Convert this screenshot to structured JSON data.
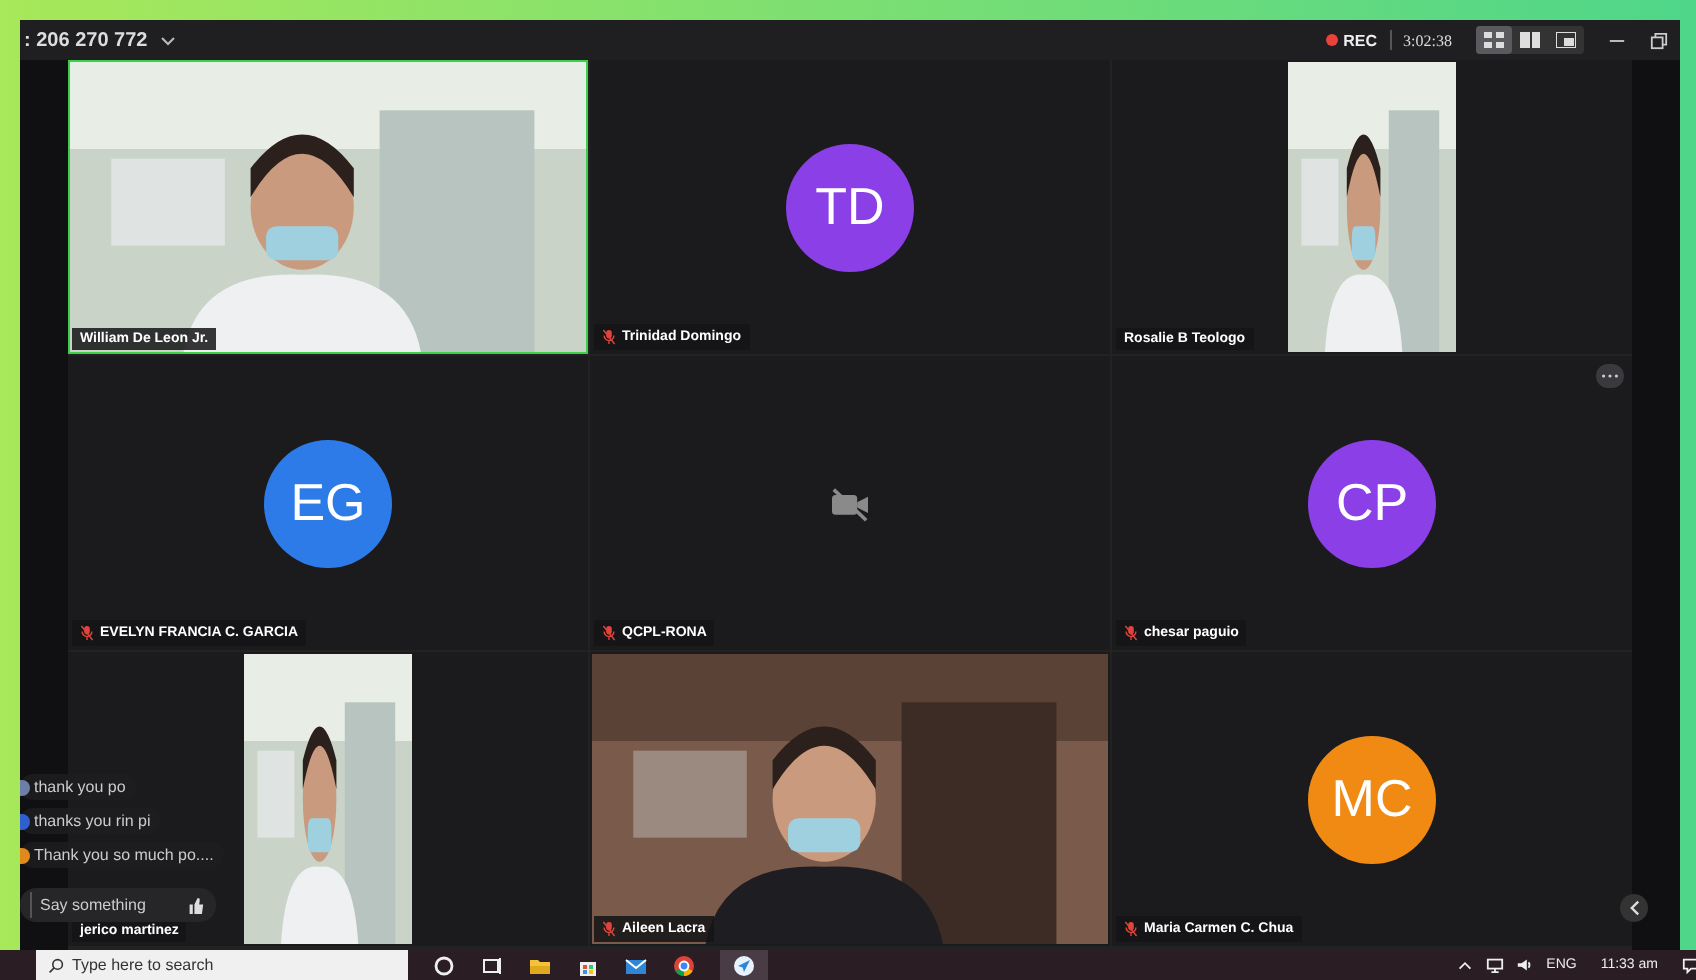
{
  "meeting": {
    "id": ": 206 270 772",
    "recording": true,
    "rec_label": "REC",
    "elapsed": "3:02:38",
    "views": [
      {
        "kind": "gallery",
        "selected": true
      },
      {
        "kind": "split",
        "selected": false
      },
      {
        "kind": "speaker",
        "selected": false
      }
    ]
  },
  "tiles": [
    {
      "kind": "video",
      "name": "William De Leon Jr.",
      "muted": false,
      "speaking": true
    },
    {
      "kind": "avatar",
      "initials": "TD",
      "color": "#8b3fe6",
      "name": "Trinidad Domingo",
      "muted": true,
      "speaking": false
    },
    {
      "kind": "portrait_video",
      "name": "Rosalie B Teologo",
      "muted": false,
      "speaking": false
    },
    {
      "kind": "avatar",
      "initials": "EG",
      "color": "#2d7be8",
      "name": "EVELYN FRANCIA C. GARCIA",
      "muted": true,
      "speaking": false
    },
    {
      "kind": "camera_off",
      "name": "QCPL-RONA",
      "muted": true,
      "speaking": false
    },
    {
      "kind": "avatar",
      "initials": "CP",
      "color": "#8b3fe6",
      "name": "chesar paguio",
      "muted": true,
      "speaking": false,
      "menu": true
    },
    {
      "kind": "portrait_video",
      "name": "jerico martinez",
      "muted": false,
      "speaking": false
    },
    {
      "kind": "video",
      "name": "Aileen Lacra",
      "muted": true,
      "speaking": false
    },
    {
      "kind": "avatar",
      "initials": "MC",
      "color": "#f08a12",
      "name": "Maria Carmen C. Chua",
      "muted": true,
      "speaking": false
    }
  ],
  "chat": {
    "messages": [
      {
        "text": "thank you po",
        "color": "#6d7fa8"
      },
      {
        "text": "thanks you rin pi",
        "color": "#2f5fd0"
      },
      {
        "text": "Thank you so much po....",
        "color": "#e08a1e"
      }
    ],
    "placeholder": "Say something"
  },
  "taskbar": {
    "search_placeholder": "Type here to search",
    "language": "ENG",
    "time": "11:33 am"
  }
}
